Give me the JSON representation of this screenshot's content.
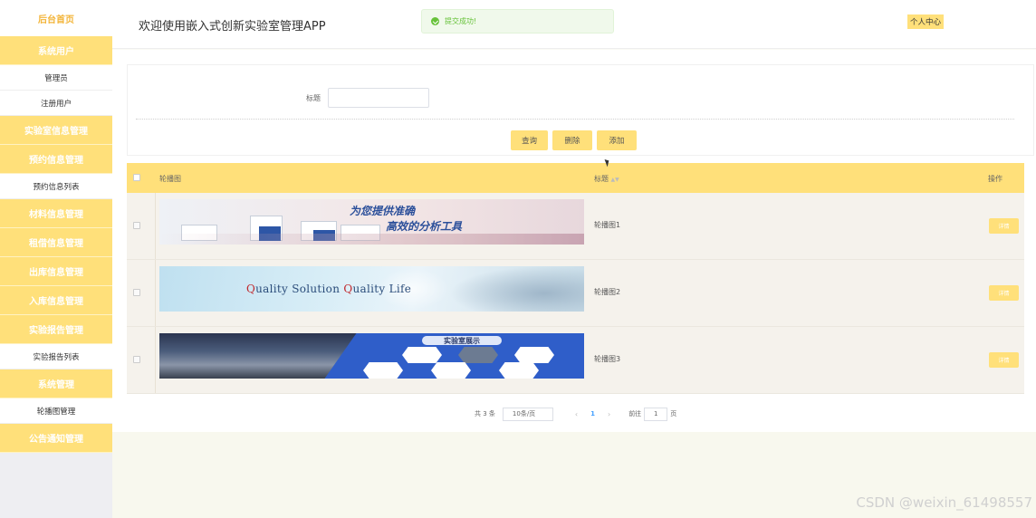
{
  "sidebar": {
    "home": "后台首页",
    "items": [
      {
        "label": "系统用户",
        "type": "group"
      },
      {
        "label": "管理员",
        "type": "sub"
      },
      {
        "label": "注册用户",
        "type": "sub"
      },
      {
        "label": "实验室信息管理",
        "type": "group"
      },
      {
        "label": "预约信息管理",
        "type": "group"
      },
      {
        "label": "预约信息列表",
        "type": "sub"
      },
      {
        "label": "材料信息管理",
        "type": "group"
      },
      {
        "label": "租借信息管理",
        "type": "group"
      },
      {
        "label": "出库信息管理",
        "type": "group"
      },
      {
        "label": "入库信息管理",
        "type": "group"
      },
      {
        "label": "实验报告管理",
        "type": "group"
      },
      {
        "label": "实验报告列表",
        "type": "sub"
      },
      {
        "label": "系统管理",
        "type": "group"
      },
      {
        "label": "轮播图管理",
        "type": "sub"
      },
      {
        "label": "公告通知管理",
        "type": "group"
      }
    ]
  },
  "header": {
    "title": "欢迎使用嵌入式创新实验室管理APP",
    "toast": "提交成功!",
    "user_center": "个人中心"
  },
  "search": {
    "label": "标题",
    "value": "",
    "query_button": "查询",
    "delete_button": "删除",
    "add_button": "添加"
  },
  "table": {
    "columns": {
      "image": "轮播图",
      "title": "标题",
      "actions": "操作"
    },
    "rows": [
      {
        "title": "轮播图1",
        "action": "详情"
      },
      {
        "title": "轮播图2",
        "action": "详情"
      },
      {
        "title": "轮播图3",
        "action": "详情"
      }
    ],
    "banners": {
      "b1_line1": "为您提供准确",
      "b1_line2": "高效的分析工具",
      "b2_text_a": "Q",
      "b2_text_b": "uality Solution  ",
      "b2_text_c": "Q",
      "b2_text_d": "uality Life",
      "b3_title": "实验室展示"
    }
  },
  "pagination": {
    "total": "共 3 条",
    "page_size": "10条/页",
    "prev": "‹",
    "current": "1",
    "next": "›",
    "goto_label": "前往",
    "goto_value": "1",
    "goto_suffix": "页"
  },
  "watermark": "CSDN @weixin_61498557",
  "colors": {
    "accent": "#ffe07a",
    "home": "#f3b53a",
    "success": "#67c23a",
    "link": "#409eff"
  }
}
